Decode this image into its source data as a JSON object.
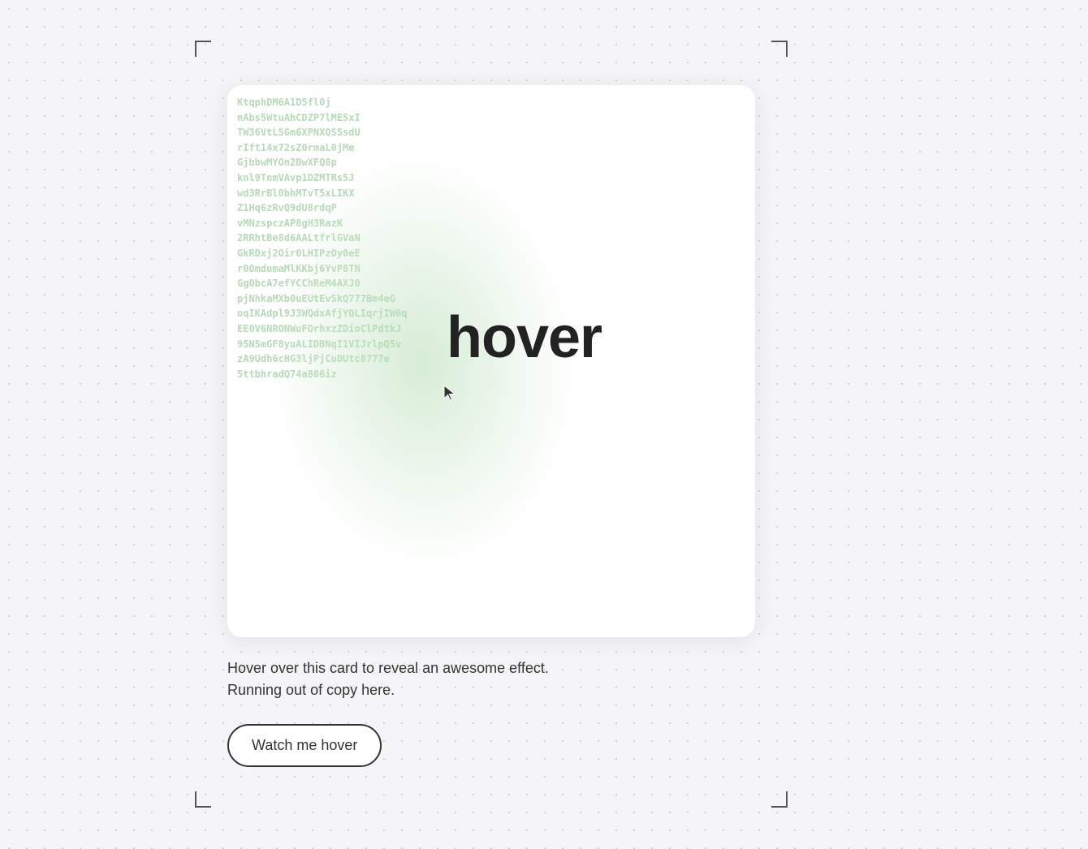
{
  "frame": {
    "bg_lines": [
      "KtqphDM6A1D5fl0j",
      "nAbs5WtuAhCDZP7lME5xI",
      "TW36VtLSGm6XPNXQSSsdU",
      "rIft14x72sZ0rmaL0jMe",
      "GjbbwMYOn2BwXFQ8p",
      "knl9TnmVAvp1DZMTRs5J",
      "wd3RrBl0bhMTvT5xLIKX",
      "Z1Hq6zRvQ9dU8rdqP",
      "vMNzspczAP8gH3RazK",
      "2RRhtBe8d6AALtfrlGVaN",
      "GkRDxj2Oir0LHIPzOy0eE",
      "r00mdumaMlKKbj6YvP8TN",
      "Gg0bcA7efYCChReM4AXJ0",
      "pjNhkaMXb0uEUtEvSkQ777Bm4eG",
      "oqIKAdpl9J3WQdxAfjYQLIqrjIW6q",
      "EE0V6NRONWuFOrhxzZDioClPdtkJ",
      "95N5mGF8yuALIDBNqI1VIJrlpQ5v",
      "zA9Udh6cHG3ljPjCuDUtc8777e",
      "5ttbhradQ74a806iz"
    ],
    "hover_word": "hover",
    "description_line1": "Hover over this card to reveal an awesome effect.",
    "description_line2": "Running out of copy here.",
    "button_label": "Watch me hover"
  }
}
